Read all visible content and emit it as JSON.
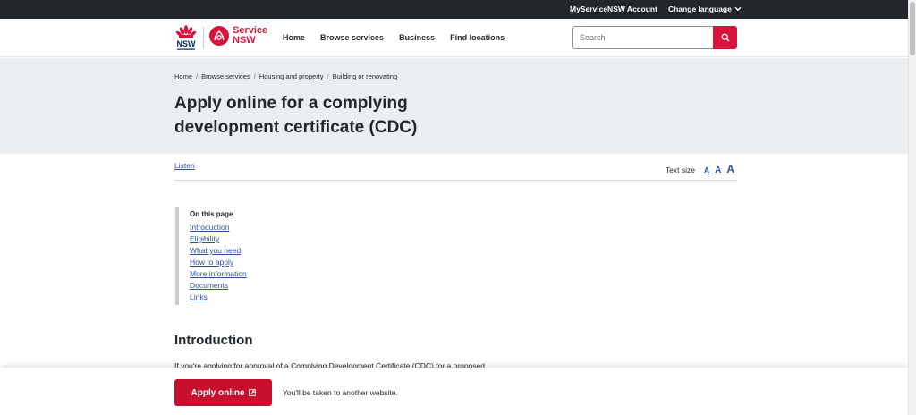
{
  "topbar": {
    "account": "MyServiceNSW Account",
    "language": "Change language"
  },
  "header": {
    "nsw_logo_text": "NSW",
    "service_word": "Service",
    "nsw_word": "NSW",
    "nav": [
      "Home",
      "Browse services",
      "Business",
      "Find locations"
    ],
    "search_placeholder": "Search"
  },
  "breadcrumb": [
    "Home",
    "Browse services",
    "Housing and property",
    "Building or renovating"
  ],
  "page_title": "Apply online for a complying development certificate (CDC)",
  "toolbar": {
    "listen": "Listen",
    "text_size_label": "Text size",
    "sizes": [
      "A",
      "A",
      "A"
    ]
  },
  "on_this_page": {
    "heading": "On this page",
    "links": [
      "Introduction",
      "Eligibility",
      "What you need",
      "How to apply",
      "More information",
      "Documents",
      "Links"
    ]
  },
  "intro": {
    "heading": "Introduction",
    "text": "If you're applying for approval of a Complying Development Certificate (CDC) for a proposed"
  },
  "footer_bar": {
    "apply_label": "Apply online",
    "note": "You'll be taken to another website."
  },
  "colors": {
    "brand_red": "#d7153a",
    "dark": "#22272b",
    "link_blue": "#2e5299",
    "hero_bg": "#ebeef1"
  }
}
